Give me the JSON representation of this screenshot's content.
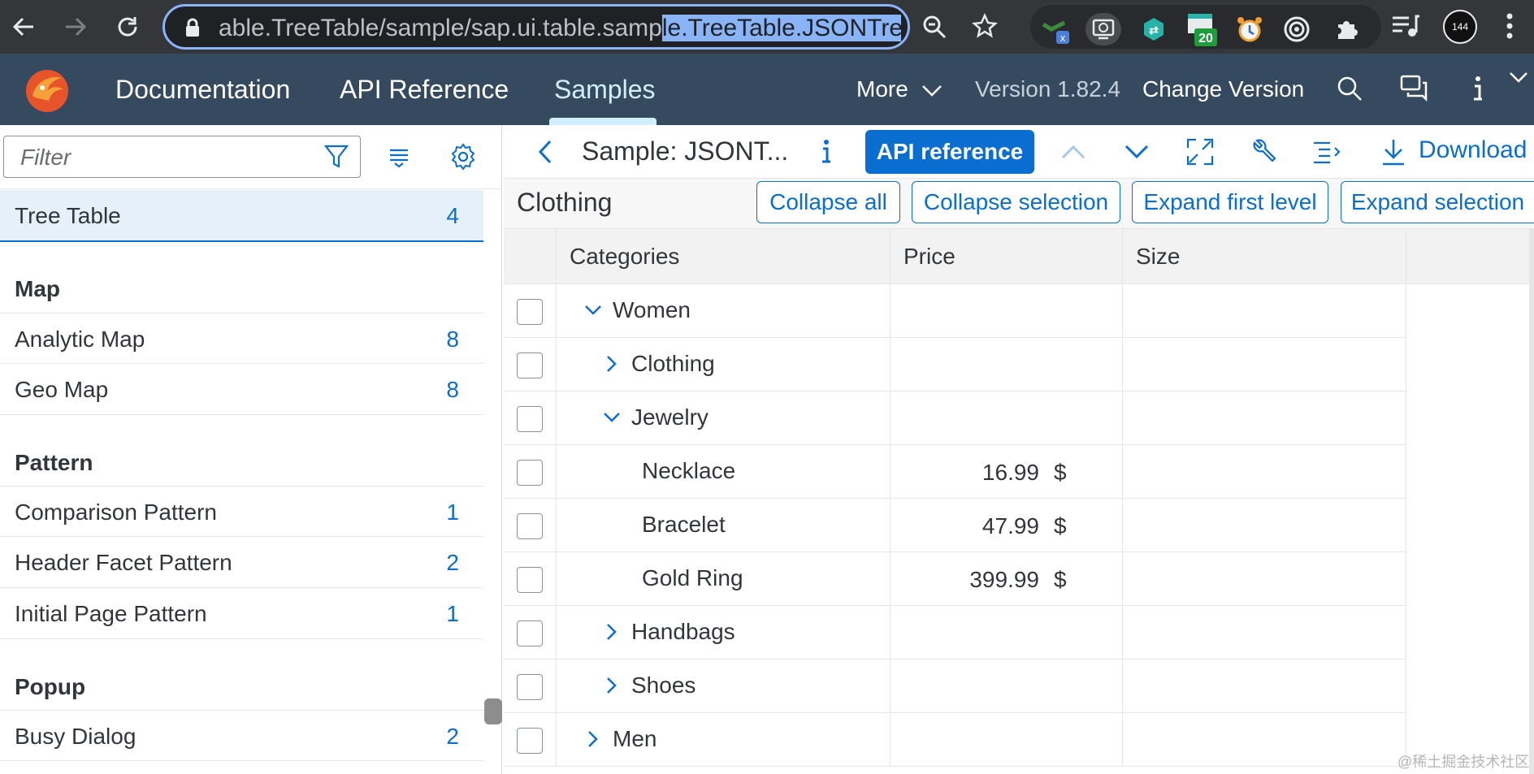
{
  "browser": {
    "url_before": "able.TreeTable/sample/sap.ui.table.samp",
    "url_selected": "le.TreeTable.JSONTreeBinding",
    "ext_badge_x": "x",
    "ext_badge_count": "20",
    "profile_badge": "144"
  },
  "shell": {
    "links": [
      "Documentation",
      "API Reference",
      "Samples"
    ],
    "active_link": "Samples",
    "more_label": "More",
    "version_label": "Version 1.82.4",
    "change_version_label": "Change Version",
    "colors": {
      "shell_bg": "#354a5f",
      "active": "#d1efff"
    }
  },
  "sidebar": {
    "filter_placeholder": "Filter",
    "selected_item": {
      "label": "Tree Table",
      "count": "4"
    },
    "groups": [
      {
        "title": "Map",
        "items": [
          {
            "label": "Analytic Map",
            "count": "8"
          },
          {
            "label": "Geo Map",
            "count": "8"
          }
        ]
      },
      {
        "title": "Pattern",
        "items": [
          {
            "label": "Comparison Pattern",
            "count": "1"
          },
          {
            "label": "Header Facet Pattern",
            "count": "2"
          },
          {
            "label": "Initial Page Pattern",
            "count": "1"
          }
        ]
      },
      {
        "title": "Popup",
        "items": [
          {
            "label": "Busy Dialog",
            "count": "2"
          }
        ]
      }
    ]
  },
  "sample_toolbar": {
    "title": "Sample: JSONT...",
    "api_reference_label": "API reference",
    "download_label": "Download",
    "accent": "#0a6ed1"
  },
  "tree_table": {
    "title": "Clothing",
    "buttons": [
      "Collapse all",
      "Collapse selection",
      "Expand first level",
      "Expand selection"
    ],
    "columns": [
      "Categories",
      "Price",
      "Size"
    ],
    "rows": [
      {
        "name": "Women",
        "state": "expanded",
        "price": "",
        "currency": "",
        "size": ""
      },
      {
        "name": "Clothing",
        "state": "collapsed",
        "price": "",
        "currency": "",
        "size": ""
      },
      {
        "name": "Jewelry",
        "state": "expanded",
        "price": "",
        "currency": "",
        "size": ""
      },
      {
        "name": "Necklace",
        "state": "leaf",
        "price": "16.99",
        "currency": "$",
        "size": ""
      },
      {
        "name": "Bracelet",
        "state": "leaf",
        "price": "47.99",
        "currency": "$",
        "size": ""
      },
      {
        "name": "Gold Ring",
        "state": "leaf",
        "price": "399.99",
        "currency": "$",
        "size": ""
      },
      {
        "name": "Handbags",
        "state": "collapsed",
        "price": "",
        "currency": "",
        "size": ""
      },
      {
        "name": "Shoes",
        "state": "collapsed",
        "price": "",
        "currency": "",
        "size": ""
      },
      {
        "name": "Men",
        "state": "collapsed",
        "price": "",
        "currency": "",
        "size": ""
      }
    ]
  },
  "watermark": "@稀土掘金技术社区"
}
